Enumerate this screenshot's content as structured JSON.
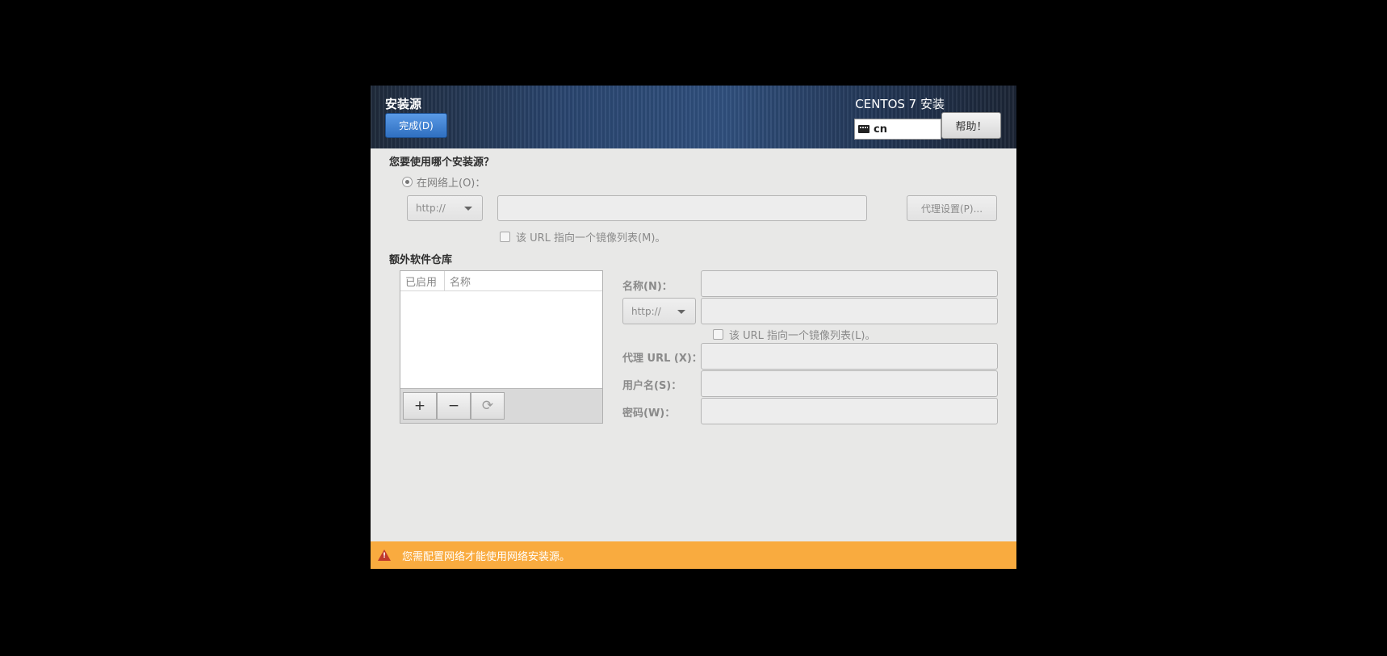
{
  "header": {
    "spoke_title": "安装源",
    "done_label": "完成(D)",
    "product_title": "CENTOS 7 安装",
    "keyboard_layout": "cn",
    "help_label": "帮助！"
  },
  "source": {
    "question": "您要使用哪个安装源？",
    "network_radio_label": "在网络上(O)：",
    "protocol": "http://",
    "url_value": "",
    "proxy_button_label": "代理设置(P)...",
    "mirrorlist_label": "该 URL 指向一个镜像列表(M)。"
  },
  "repos": {
    "heading": "额外软件仓库",
    "columns": [
      "已启用",
      "名称"
    ],
    "rows": [],
    "add_symbol": "+",
    "remove_symbol": "−",
    "reset_symbol": "⟳"
  },
  "repo_form": {
    "name_label": "名称(N)：",
    "name_value": "",
    "protocol": "http://",
    "url_value": "",
    "mirrorlist_label": "该 URL 指向一个镜像列表(L)。",
    "proxy_url_label": "代理 URL (X)：",
    "username_label": "用户名(S)：",
    "password_label": "密码(W)："
  },
  "warning": {
    "message": "您需配置网络才能使用网络安装源。",
    "color": "#f9ab3f"
  },
  "icons": {
    "keyboard": "keyboard-icon",
    "warning": "warning-icon",
    "dropdown": "chevron-down-icon"
  }
}
